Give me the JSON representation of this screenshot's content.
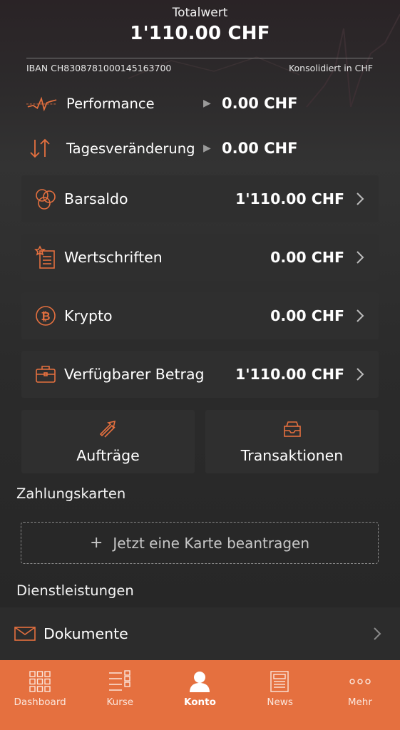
{
  "header": {
    "total_label": "Totalwert",
    "total_value": "1'110.00 CHF",
    "iban": "IBAN CH8308781000145163700",
    "consolidated": "Konsolidiert in CHF"
  },
  "performance": [
    {
      "label": "Performance",
      "value": "0.00 CHF",
      "icon": "performance-chart-icon"
    },
    {
      "label": "Tagesveränderung",
      "value": "0.00 CHF",
      "icon": "up-down-arrows-icon"
    }
  ],
  "accounts": [
    {
      "label": "Barsaldo",
      "value": "1'110.00 CHF",
      "icon": "coins-icon"
    },
    {
      "label": "Wertschriften",
      "value": "0.00 CHF",
      "icon": "securities-document-icon"
    },
    {
      "label": "Krypto",
      "value": "0.00 CHF",
      "icon": "bitcoin-icon"
    },
    {
      "label": "Verfügbarer Betrag",
      "value": "1'110.00 CHF",
      "icon": "briefcase-icon"
    }
  ],
  "tiles": {
    "orders": "Aufträge",
    "transactions": "Transaktionen"
  },
  "cards_section": {
    "title": "Zahlungskarten",
    "plus": "+",
    "add_label": "Jetzt eine Karte beantragen"
  },
  "services_section": {
    "title": "Dienstleistungen",
    "documents": "Dokumente"
  },
  "tabbar": {
    "active": "Konto",
    "items": [
      {
        "label": "Dashboard",
        "icon": "grid-icon"
      },
      {
        "label": "Kurse",
        "icon": "list-icon"
      },
      {
        "label": "Konto",
        "icon": "person-icon"
      },
      {
        "label": "News",
        "icon": "newspaper-icon"
      },
      {
        "label": "Mehr",
        "icon": "more-dots-icon"
      }
    ]
  },
  "colors": {
    "accent": "#e5703f",
    "background": "#262626",
    "card": "#2f2f2f"
  }
}
